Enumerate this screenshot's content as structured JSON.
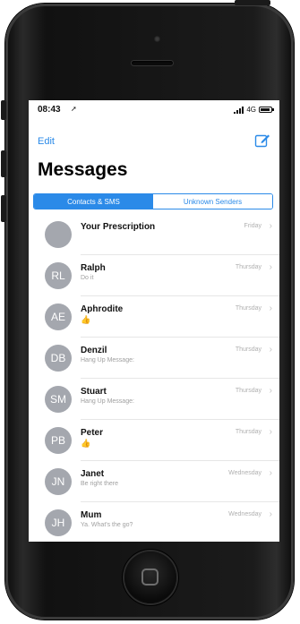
{
  "status": {
    "time": "08:43",
    "network": "4G"
  },
  "nav": {
    "edit_label": "Edit",
    "title": "Messages"
  },
  "segments": {
    "contacts_label": "Contacts & SMS",
    "unknown_label": "Unknown Senders"
  },
  "messages": [
    {
      "initials": "",
      "name": "Your Prescription",
      "preview": "",
      "date": "Friday"
    },
    {
      "initials": "RL",
      "name": "Ralph",
      "preview": "Do it",
      "date": "Thursday"
    },
    {
      "initials": "AE",
      "name": "Aphrodite",
      "preview": "👍",
      "date": "Thursday"
    },
    {
      "initials": "DB",
      "name": "Denzil",
      "preview": "Hang Up Message:",
      "date": "Thursday"
    },
    {
      "initials": "SM",
      "name": "Stuart",
      "preview": "Hang Up Message:",
      "date": "Thursday"
    },
    {
      "initials": "PB",
      "name": "Peter",
      "preview": "👍",
      "date": "Thursday"
    },
    {
      "initials": "JN",
      "name": "Janet",
      "preview": "Be right there",
      "date": "Wednesday"
    },
    {
      "initials": "JH",
      "name": "Mum",
      "preview": "Ya. What's the go?",
      "date": "Wednesday"
    }
  ],
  "icons": {
    "compose": "compose-icon",
    "chevron": "chevron-right-icon",
    "location": "location-arrow-icon"
  },
  "colors": {
    "accent": "#2b8ae8",
    "avatar": "#a4a7ae"
  }
}
